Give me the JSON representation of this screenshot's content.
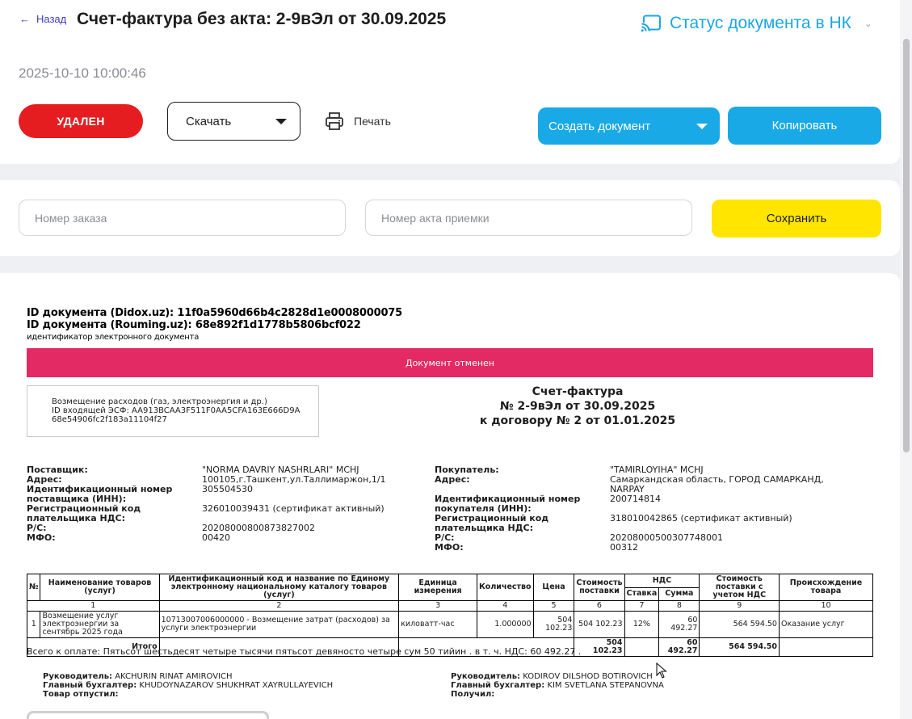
{
  "header": {
    "back_label": "Назад",
    "title": "Счет-фактура без акта: 2-9вЭл от 30.09.2025",
    "status_nk_label": "Статус документа в НК",
    "timestamp": "2025-10-10 10:00:46"
  },
  "actions": {
    "status_badge": "УДАЛЕН",
    "download_label": "Скачать",
    "print_label": "Печать",
    "create_doc_label": "Создать документ",
    "copy_label": "Копировать"
  },
  "order": {
    "order_number_placeholder": "Номер заказа",
    "act_number_placeholder": "Номер акта приемки",
    "save_label": "Сохранить"
  },
  "document": {
    "id_didox": "ID документа (Didox.uz): 11f0a5960d66b4c2828d1e0008000075",
    "id_rouming": "ID документа (Rouming.uz): 68e892f1d1778b5806bcf022",
    "id_caption": "идентификатор электронного документа",
    "cancel_banner": "Документ отменен",
    "reason_line1": "Возмещение расходов (газ, электроэнергия и др.)",
    "reason_line2": "ID входящей ЭСФ: AA913BCAA3F511F0AA5CFA163E666D9A",
    "reason_line3": "68e54906fc2f183a11104f27",
    "inv_title": "Счет-фактура",
    "inv_number": "№ 2-9вЭл от 30.09.2025",
    "inv_contract": "к договору № 2 от 01.01.2025",
    "supplier": {
      "l_name": "Поставщик:",
      "name": "\"NORMA DAVRIY NASHRLARI\" MCHJ",
      "l_address": "Адрес:",
      "address": "100105,г.Ташкент,ул.Таллимаржон,1/1",
      "l_inn": "Идентификационный номер поставщика (ИНН):",
      "inn": "305504530",
      "l_vat": "Регистрационный код плательщика НДС:",
      "vat": "326010039431 (сертификат активный)",
      "l_rs": "Р/С:",
      "rs": "20208000800873827002",
      "l_mfo": "МФО:",
      "mfo": "00420"
    },
    "buyer": {
      "l_name": "Покупатель:",
      "name": "\"TAMIRLOYIHA\" MCHJ",
      "l_address": "Адрес:",
      "address": "Самаркандская область, ГОРОД САМАРКАНД, NARPAY",
      "l_inn": "Идентификационный номер покупателя (ИНН):",
      "inn": "200714814",
      "l_vat": "Регистрационный код плательщика НДС:",
      "vat": "318010042865 (сертификат активный)",
      "l_rs": "Р/С:",
      "rs": "20208000500307748001",
      "l_mfo": "МФО:",
      "mfo": "00312"
    },
    "table": {
      "h_no": "№",
      "h_name": "Наименование товаров (услуг)",
      "h_code": "Идентификационный код и название по Единому электронному национальному каталогу товаров (услуг)",
      "h_unit": "Единица измерения",
      "h_qty": "Количество",
      "h_price": "Цена",
      "h_cost": "Стоимость поставки",
      "h_vat": "НДС",
      "h_rate": "Ставка",
      "h_sum": "Сумма",
      "h_total": "Стоимость поставки с учетом НДС",
      "h_origin": "Происхождение товара",
      "nums": [
        "1",
        "2",
        "3",
        "4",
        "5",
        "6",
        "7",
        "8",
        "9",
        "10"
      ],
      "row": {
        "no": "1",
        "name": "Возмещение услуг электроэнергии за сентябрь 2025 года",
        "code": "10713007006000000 - Возмещение затрат (расходов) за услуги электроэнергии",
        "unit": "киловатт-час",
        "qty": "1.000000",
        "price": "504 102.23",
        "cost": "504 102.23",
        "rate": "12%",
        "sum": "60 492.27",
        "total": "564 594.50",
        "origin": "Оказание услуг"
      },
      "totals_label": "Итого",
      "total_cost": "504 102.23",
      "total_sum": "60 492.27",
      "total_with_vat": "564 594.50"
    },
    "total_text": "Всего к оплате: Пятьсот шестьдесят четыре тысячи пятьсот девяносто четыре сум 50 тийин . в т. ч. НДС: 60 492.27 .",
    "sign_left": {
      "l_head": "Руководитель:",
      "head": "AKCHURIN RINAT AMIROVICH",
      "l_acc": "Главный бухгалтер:",
      "acc": "KHUDOYNAZAROV SHUKHRAT XAYRULLAYEVICH",
      "l_rel": "Товар отпустил:"
    },
    "sign_right": {
      "l_head": "Руководитель:",
      "head": "KODIROV DILSHOD BOTIROVICH",
      "l_acc": "Главный бухгалтер:",
      "acc": "KIM SVETLANA STEPANOVNA",
      "l_rec": "Получил:"
    }
  },
  "colors": {
    "accent_blue": "#18a9e6",
    "deleted_red": "#e51d21",
    "save_yellow": "#ffe500",
    "cancel_banner": "#e32a65"
  }
}
